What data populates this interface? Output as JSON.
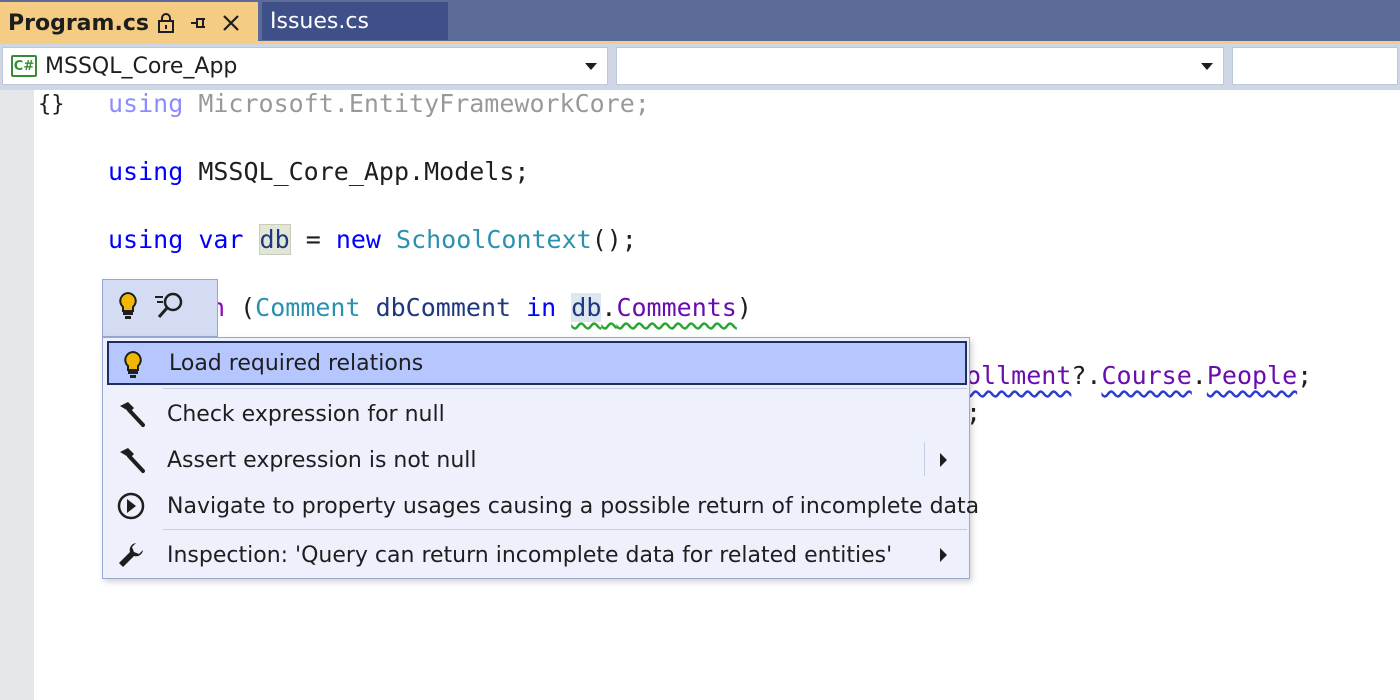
{
  "tabs": [
    {
      "label": "Program.cs",
      "active": true
    },
    {
      "label": "Issues.cs",
      "active": false
    }
  ],
  "navbar": {
    "project_combo": "MSSQL_Core_App",
    "project_badge": "C#",
    "member_combo": "",
    "third_combo": ""
  },
  "editor": {
    "namespace_glyph": "{}",
    "line1": {
      "kw": "using",
      "rest": " Microsoft.EntityFrameworkCore;"
    },
    "line2": {
      "kw": "using",
      "rest": " MSSQL_Core_App.Models;"
    },
    "line3": {
      "kw1": "using",
      "kw2": "var",
      "var": "db",
      "op": " = ",
      "kw3": "new",
      "type": "SchoolContext",
      "tail": "();"
    },
    "line4": {
      "kw": "h",
      "p1": " (",
      "type": "Comment",
      "var": " dbComment ",
      "in": "in",
      "db": "db",
      "dot": ".",
      "prop": "Comments",
      "close": ")"
    },
    "line5": {
      "a": "ollment",
      "b": "?.",
      "c": "Course",
      "d": ".",
      "e": "People",
      "f": ";"
    },
    "line6": {
      "a": ";"
    }
  },
  "menu": {
    "items": [
      {
        "label": "Load required relations",
        "icon": "lightbulb-icon",
        "selected": true,
        "submenu": false
      },
      {
        "label": "Check expression for null",
        "icon": "hammer-icon",
        "selected": false,
        "submenu": false
      },
      {
        "label": "Assert expression is not null",
        "icon": "hammer-icon",
        "selected": false,
        "submenu": true
      },
      {
        "label": "Navigate to property usages causing a possible return of incomplete data",
        "icon": "navigate-icon",
        "selected": false,
        "submenu": false
      },
      {
        "label": "Inspection: 'Query can return incomplete data for related entities'",
        "icon": "wrench-icon",
        "selected": false,
        "submenu": true
      }
    ]
  },
  "colors": {
    "tab_active": "#f5cc84",
    "tab_strip": "#5d6b99",
    "menu_selected": "#b6c7ff",
    "keyword": "#0000ff",
    "type": "#2b91af",
    "property": "#6a0dad"
  }
}
